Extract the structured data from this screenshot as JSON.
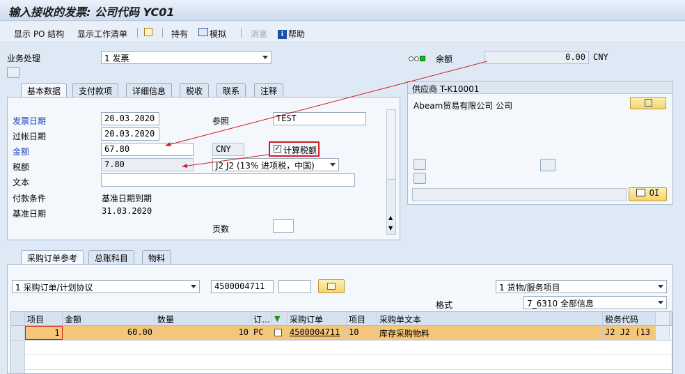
{
  "title": "输入接收的发票: 公司代码 YC01",
  "toolbar": {
    "show_po_structure": "显示 PO 结构",
    "show_worklist": "显示工作清单",
    "hold": "持有",
    "simulate": "模拟",
    "messages": "消息",
    "help": "帮助"
  },
  "header": {
    "transaction_label": "业务处理",
    "transaction_value": "1 发票",
    "balance_label": "余额",
    "balance_value": "0.00",
    "balance_currency": "CNY"
  },
  "basic_tabs": [
    "基本数据",
    "支付款项",
    "详细信息",
    "税收",
    "联系",
    "注释"
  ],
  "basic": {
    "invoice_date_label": "发票日期",
    "invoice_date": "20.03.2020",
    "reference_label": "参照",
    "reference": "TEST",
    "posting_date_label": "过帐日期",
    "posting_date": "20.03.2020",
    "amount_label": "金额",
    "amount": "67.80",
    "currency": "CNY",
    "calc_tax_label": "计算税额",
    "calc_tax_checked": true,
    "tax_label": "税额",
    "tax_amount": "7.80",
    "tax_code": "J2 J2 (13% 进项税，中国)",
    "text_label": "文本",
    "text_value": "",
    "payment_terms_label": "付款条件",
    "payment_terms_value": "基准日期到期",
    "baseline_date_label": "基准日期",
    "baseline_date": "31.03.2020",
    "page_label": "页数",
    "page_value": ""
  },
  "vendor": {
    "title": "供应商 T-K10001",
    "name": "Abeam贸易有限公司 公司",
    "oi_label": "OI"
  },
  "po_tabs": [
    "采购订单参考",
    "总账科目",
    "物料"
  ],
  "po_ref": {
    "ref_type": "1 采购订单/计划协议",
    "po_number": "4500004711",
    "po_item": "",
    "item_type": "1 货物/服务项目",
    "layout_label": "格式",
    "layout_value": "7_6310 全部信息"
  },
  "grid": {
    "columns": [
      "项目",
      "金额",
      "数量",
      "订…",
      "",
      "采购订单",
      "项目",
      "采购单文本",
      "税务代码"
    ],
    "rows": [
      {
        "item": "1",
        "amount": "60.00",
        "qty": "10",
        "unit": "PC",
        "checked": false,
        "po": "4500004711",
        "po_item": "10",
        "text": "库存采购物料",
        "tax": "J2 J2 (13"
      }
    ]
  },
  "colors": {
    "accent_red": "#cc1f1f",
    "selected_row": "#f4c67a"
  }
}
